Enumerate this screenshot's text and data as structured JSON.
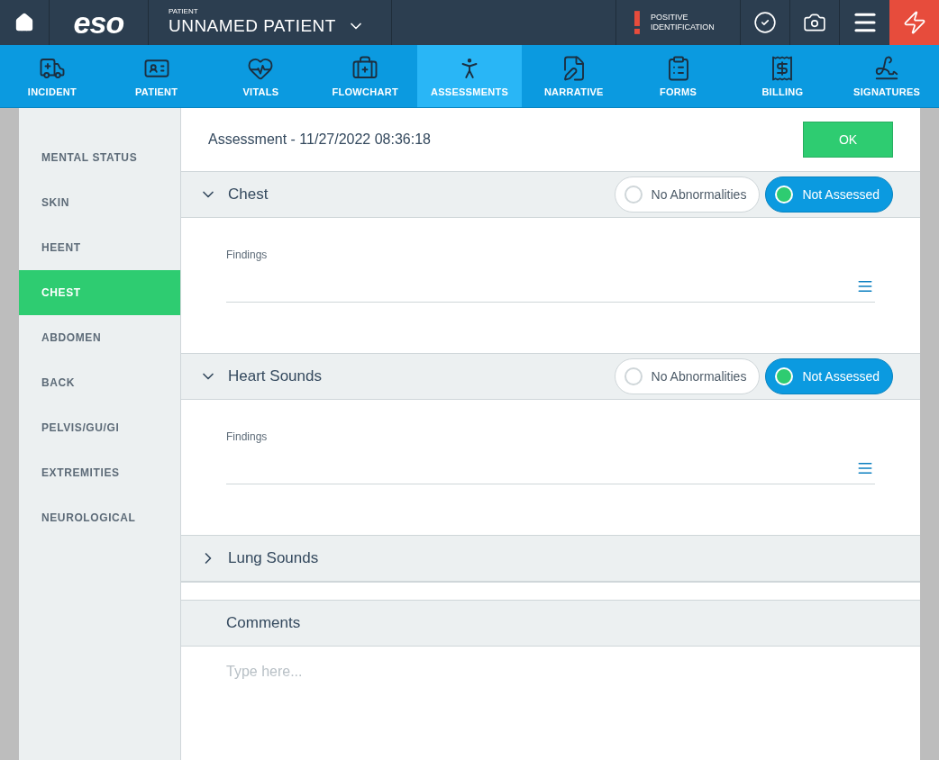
{
  "top_bar": {
    "logo": "eso",
    "patient_label": "PATIENT",
    "patient_name": "UNNAMED PATIENT",
    "identification": "POSITIVE IDENTIFICATION"
  },
  "nav_tabs": [
    {
      "label": "INCIDENT",
      "selected": false
    },
    {
      "label": "PATIENT",
      "selected": false
    },
    {
      "label": "VITALS",
      "selected": false
    },
    {
      "label": "FLOWCHART",
      "selected": false
    },
    {
      "label": "ASSESSMENTS",
      "selected": true
    },
    {
      "label": "NARRATIVE",
      "selected": false
    },
    {
      "label": "FORMS",
      "selected": false
    },
    {
      "label": "BILLING",
      "selected": false
    },
    {
      "label": "SIGNATURES",
      "selected": false
    }
  ],
  "sidebar": {
    "items": [
      {
        "label": "MENTAL STATUS",
        "selected": false
      },
      {
        "label": "SKIN",
        "selected": false
      },
      {
        "label": "HEENT",
        "selected": false
      },
      {
        "label": "CHEST",
        "selected": true
      },
      {
        "label": "ABDOMEN",
        "selected": false
      },
      {
        "label": "BACK",
        "selected": false
      },
      {
        "label": "PELVIS/GU/GI",
        "selected": false
      },
      {
        "label": "EXTREMITIES",
        "selected": false
      },
      {
        "label": "NEUROLOGICAL",
        "selected": false
      }
    ]
  },
  "header": {
    "title": "Assessment - 11/27/2022 08:36:18",
    "ok_button": "OK"
  },
  "sections": [
    {
      "title": "Chest",
      "expanded": true,
      "options": [
        {
          "label": "No Abnormalities",
          "selected": false
        },
        {
          "label": "Not Assessed",
          "selected": true
        }
      ],
      "findings_label": "Findings"
    },
    {
      "title": "Heart Sounds",
      "expanded": true,
      "options": [
        {
          "label": "No Abnormalities",
          "selected": false
        },
        {
          "label": "Not Assessed",
          "selected": true
        }
      ],
      "findings_label": "Findings"
    },
    {
      "title": "Lung Sounds",
      "expanded": false
    }
  ],
  "comments": {
    "title": "Comments",
    "placeholder": "Type here..."
  }
}
